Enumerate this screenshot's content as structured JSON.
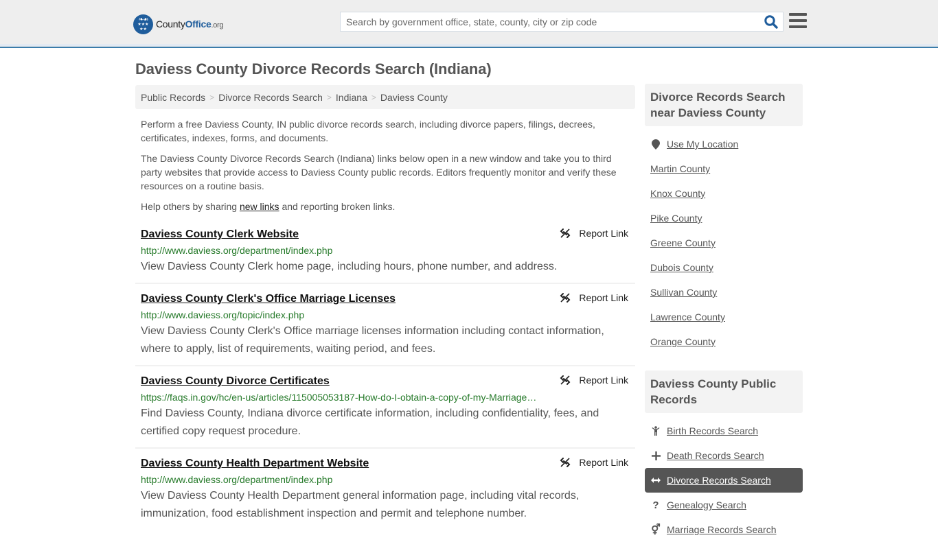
{
  "header": {
    "logo": {
      "name_part1": "County",
      "name_part2": "Office",
      "name_suffix": ".org"
    },
    "search_placeholder": "Search by government office, state, county, city or zip code",
    "search_icon": "search-icon",
    "menu_icon": "hamburger-menu-icon",
    "colors": {
      "brand": "#1f5d9c",
      "header_border": "#3a7cab"
    }
  },
  "page": {
    "title": "Daviess County Divorce Records Search (Indiana)"
  },
  "breadcrumb": [
    {
      "label": "Public Records"
    },
    {
      "label": "Divorce Records Search"
    },
    {
      "label": "Indiana"
    },
    {
      "label": "Daviess County"
    }
  ],
  "intro": {
    "p1": "Perform a free Daviess County, IN public divorce records search, including divorce papers, filings, decrees, certificates, indexes, forms, and documents.",
    "p2": "The Daviess County Divorce Records Search (Indiana) links below open in a new window and take you to third party websites that provide access to Daviess County public records. Editors frequently monitor and verify these resources on a routine basis.",
    "p3_before": "Help others by sharing ",
    "p3_link": "new links",
    "p3_after": " and reporting broken links."
  },
  "results": [
    {
      "title": "Daviess County Clerk Website",
      "url": "http://www.daviess.org/department/index.php",
      "description": "View Daviess County Clerk home page, including hours, phone number, and address.",
      "report_label": "Report Link"
    },
    {
      "title": "Daviess County Clerk's Office Marriage Licenses",
      "url": "http://www.daviess.org/topic/index.php",
      "description": "View Daviess County Clerk's Office marriage licenses information including contact information, where to apply, list of requirements, waiting period, and fees.",
      "report_label": "Report Link"
    },
    {
      "title": "Daviess County Divorce Certificates",
      "url": "https://faqs.in.gov/hc/en-us/articles/115005053187-How-do-I-obtain-a-copy-of-my-Marriage…",
      "description": "Find Daviess County, Indiana divorce certificate information, including confidentiality, fees, and certified copy request procedure.",
      "report_label": "Report Link"
    },
    {
      "title": "Daviess County Health Department Website",
      "url": "http://www.daviess.org/department/index.php",
      "description": "View Daviess County Health Department general information page, including vital records, immunization, food establishment inspection and permit and telephone number.",
      "report_label": "Report Link"
    }
  ],
  "sidebar": {
    "nearby": {
      "heading": "Divorce Records Search near Daviess County",
      "use_location": "Use My Location",
      "items": [
        {
          "label": "Martin County"
        },
        {
          "label": "Knox County"
        },
        {
          "label": "Pike County"
        },
        {
          "label": "Greene County"
        },
        {
          "label": "Dubois County"
        },
        {
          "label": "Sullivan County"
        },
        {
          "label": "Lawrence County"
        },
        {
          "label": "Orange County"
        }
      ]
    },
    "public_records": {
      "heading": "Daviess County Public Records",
      "items": [
        {
          "label": "Birth Records Search",
          "icon": "child-icon",
          "active": false
        },
        {
          "label": "Death Records Search",
          "icon": "cross-icon",
          "active": false
        },
        {
          "label": "Divorce Records Search",
          "icon": "arrows-horizontal-icon",
          "active": true
        },
        {
          "label": "Genealogy Search",
          "icon": "question-icon",
          "active": false
        },
        {
          "label": "Marriage Records Search",
          "icon": "marriage-symbol-icon",
          "active": false
        }
      ]
    }
  }
}
